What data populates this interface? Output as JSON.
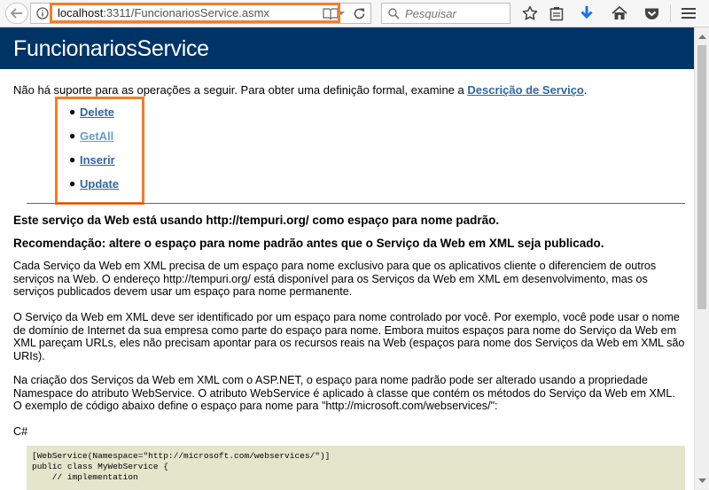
{
  "browser": {
    "url_host": "localhost",
    "url_rest": ":3311/FuncionariosService.asmx",
    "search_placeholder": "Pesquisar"
  },
  "page": {
    "title": "FuncionariosService",
    "intro_text": "Não há suporte para as operações a seguir. Para obter uma definição formal, examine a ",
    "intro_link": "Descrição de Serviço",
    "intro_end": ".",
    "operations": [
      "Delete",
      "GetAll",
      "Inserir",
      "Update"
    ],
    "namespace_heading": "Este serviço da Web está usando http://tempuri.org/ como espaço para nome padrão.",
    "recommendation_heading": "Recomendação: altere o espaço para nome padrão antes que o Serviço da Web em XML seja publicado.",
    "paragraph1": "Cada Serviço da Web em XML precisa de um espaço para nome exclusivo para que os aplicativos cliente o diferenciem de outros serviços na Web. O endereço http://tempuri.org/ está disponível para os Serviços da Web em XML em desenvolvimento, mas os serviços publicados devem usar um espaço para nome permanente.",
    "paragraph2": "O Serviço da Web em XML deve ser identificado por um espaço para nome controlado por você. Por exemplo, você pode usar o nome de domínio de Internet da sua empresa como parte do espaço para nome. Embora muitos espaços para nome do Serviço da Web em XML pareçam URLs, eles não precisam apontar para os recursos reais na Web (espaços para nome dos Serviços da Web em XML são URIs).",
    "paragraph3": "Na criação dos Serviços da Web em XML com o ASP.NET, o espaço para nome padrão pode ser alterado usando a propriedade Namespace do atributo WebService. O atributo WebService é aplicado à classe que contém os métodos do Serviço da Web em XML. O exemplo de código abaixo define o espaço para nome para \"http://microsoft.com/webservices/\":",
    "code_language": "C#",
    "code_sample": "[WebService(Namespace=\"http://microsoft.com/webservices/\")]\npublic class MyWebService {\n    // implementation"
  }
}
